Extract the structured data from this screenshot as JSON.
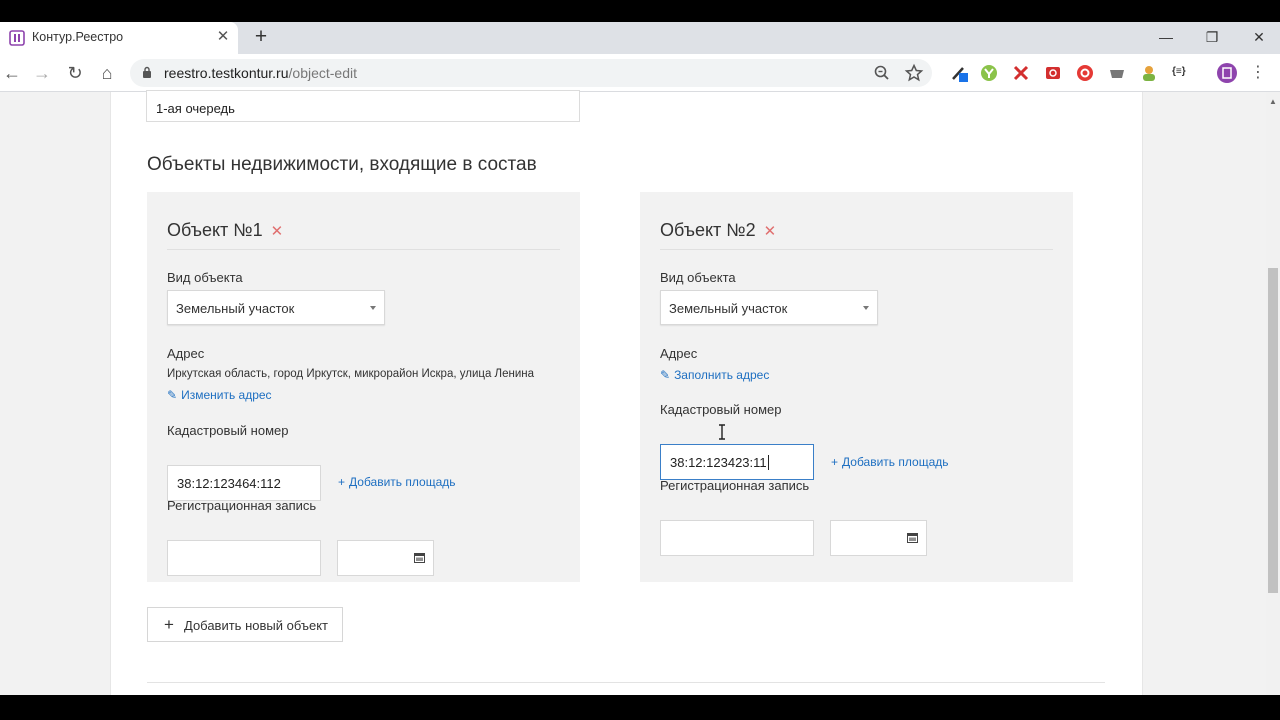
{
  "browser": {
    "tab_title": "Контур.Реестро",
    "url_host": "reestro.testkontur.ru",
    "url_path": "/object-edit",
    "accent": "#8e44ad"
  },
  "page": {
    "queue_value": "1-ая очередь",
    "section_title": "Объекты недвижимости, входящие в состав",
    "add_object_label": "Добавить новый объект",
    "objects": [
      {
        "title": "Объект №1",
        "type_label": "Вид объекта",
        "type_value": "Земельный участок",
        "address_label": "Адрес",
        "address_text": "Иркутская область, город Иркутск, микрорайон Искра, улица Ленина",
        "address_link": "Изменить адрес",
        "cadastral_label": "Кадастровый номер",
        "cadastral_value": "38:12:123464:112",
        "add_area_link": "Добавить площадь",
        "registration_label": "Регистрационная запись"
      },
      {
        "title": "Объект №2",
        "type_label": "Вид объекта",
        "type_value": "Земельный участок",
        "address_label": "Адрес",
        "address_link": "Заполнить адрес",
        "cadastral_label": "Кадастровый номер",
        "cadastral_value": "38:12:123423:11",
        "add_area_link": "Добавить площадь",
        "registration_label": "Регистрационная запись"
      }
    ]
  }
}
